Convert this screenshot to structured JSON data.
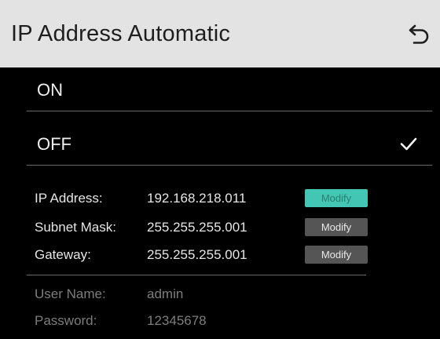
{
  "header": {
    "title": "IP Address Automatic",
    "back_icon": "back-arrow-icon"
  },
  "options": [
    {
      "label": "ON",
      "selected": false
    },
    {
      "label": "OFF",
      "selected": true
    }
  ],
  "network": {
    "ip_address": {
      "label": "IP Address:",
      "value": "192.168.218.011",
      "button": "Modify"
    },
    "subnet_mask": {
      "label": "Subnet Mask:",
      "value": "255.255.255.001",
      "button": "Modify"
    },
    "gateway": {
      "label": "Gateway:",
      "value": "255.255.255.001",
      "button": "Modify"
    }
  },
  "account": {
    "user_name": {
      "label": "User Name:",
      "value": "admin"
    },
    "password": {
      "label": "Password:",
      "value": "12345678"
    }
  },
  "colors": {
    "header_bg": "#e3e3e3",
    "accent": "#43c7b4",
    "button_gray": "#555555"
  }
}
